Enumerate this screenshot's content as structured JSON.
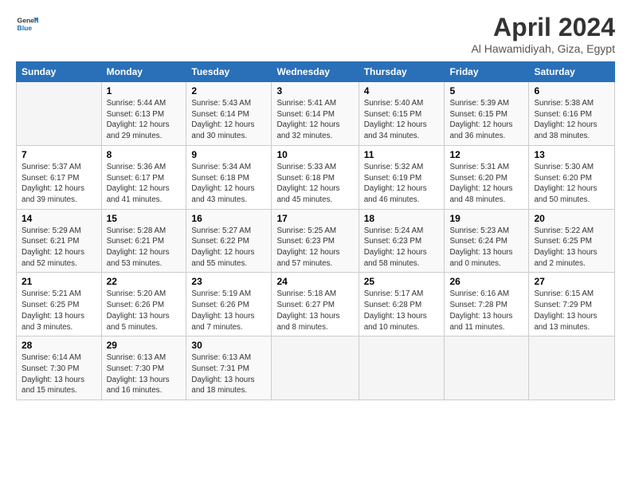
{
  "logo": {
    "line1": "General",
    "line2": "Blue"
  },
  "title": "April 2024",
  "location": "Al Hawamidiyah, Giza, Egypt",
  "days_header": [
    "Sunday",
    "Monday",
    "Tuesday",
    "Wednesday",
    "Thursday",
    "Friday",
    "Saturday"
  ],
  "weeks": [
    [
      {
        "num": "",
        "info": ""
      },
      {
        "num": "1",
        "info": "Sunrise: 5:44 AM\nSunset: 6:13 PM\nDaylight: 12 hours\nand 29 minutes."
      },
      {
        "num": "2",
        "info": "Sunrise: 5:43 AM\nSunset: 6:14 PM\nDaylight: 12 hours\nand 30 minutes."
      },
      {
        "num": "3",
        "info": "Sunrise: 5:41 AM\nSunset: 6:14 PM\nDaylight: 12 hours\nand 32 minutes."
      },
      {
        "num": "4",
        "info": "Sunrise: 5:40 AM\nSunset: 6:15 PM\nDaylight: 12 hours\nand 34 minutes."
      },
      {
        "num": "5",
        "info": "Sunrise: 5:39 AM\nSunset: 6:15 PM\nDaylight: 12 hours\nand 36 minutes."
      },
      {
        "num": "6",
        "info": "Sunrise: 5:38 AM\nSunset: 6:16 PM\nDaylight: 12 hours\nand 38 minutes."
      }
    ],
    [
      {
        "num": "7",
        "info": "Sunrise: 5:37 AM\nSunset: 6:17 PM\nDaylight: 12 hours\nand 39 minutes."
      },
      {
        "num": "8",
        "info": "Sunrise: 5:36 AM\nSunset: 6:17 PM\nDaylight: 12 hours\nand 41 minutes."
      },
      {
        "num": "9",
        "info": "Sunrise: 5:34 AM\nSunset: 6:18 PM\nDaylight: 12 hours\nand 43 minutes."
      },
      {
        "num": "10",
        "info": "Sunrise: 5:33 AM\nSunset: 6:18 PM\nDaylight: 12 hours\nand 45 minutes."
      },
      {
        "num": "11",
        "info": "Sunrise: 5:32 AM\nSunset: 6:19 PM\nDaylight: 12 hours\nand 46 minutes."
      },
      {
        "num": "12",
        "info": "Sunrise: 5:31 AM\nSunset: 6:20 PM\nDaylight: 12 hours\nand 48 minutes."
      },
      {
        "num": "13",
        "info": "Sunrise: 5:30 AM\nSunset: 6:20 PM\nDaylight: 12 hours\nand 50 minutes."
      }
    ],
    [
      {
        "num": "14",
        "info": "Sunrise: 5:29 AM\nSunset: 6:21 PM\nDaylight: 12 hours\nand 52 minutes."
      },
      {
        "num": "15",
        "info": "Sunrise: 5:28 AM\nSunset: 6:21 PM\nDaylight: 12 hours\nand 53 minutes."
      },
      {
        "num": "16",
        "info": "Sunrise: 5:27 AM\nSunset: 6:22 PM\nDaylight: 12 hours\nand 55 minutes."
      },
      {
        "num": "17",
        "info": "Sunrise: 5:25 AM\nSunset: 6:23 PM\nDaylight: 12 hours\nand 57 minutes."
      },
      {
        "num": "18",
        "info": "Sunrise: 5:24 AM\nSunset: 6:23 PM\nDaylight: 12 hours\nand 58 minutes."
      },
      {
        "num": "19",
        "info": "Sunrise: 5:23 AM\nSunset: 6:24 PM\nDaylight: 13 hours\nand 0 minutes."
      },
      {
        "num": "20",
        "info": "Sunrise: 5:22 AM\nSunset: 6:25 PM\nDaylight: 13 hours\nand 2 minutes."
      }
    ],
    [
      {
        "num": "21",
        "info": "Sunrise: 5:21 AM\nSunset: 6:25 PM\nDaylight: 13 hours\nand 3 minutes."
      },
      {
        "num": "22",
        "info": "Sunrise: 5:20 AM\nSunset: 6:26 PM\nDaylight: 13 hours\nand 5 minutes."
      },
      {
        "num": "23",
        "info": "Sunrise: 5:19 AM\nSunset: 6:26 PM\nDaylight: 13 hours\nand 7 minutes."
      },
      {
        "num": "24",
        "info": "Sunrise: 5:18 AM\nSunset: 6:27 PM\nDaylight: 13 hours\nand 8 minutes."
      },
      {
        "num": "25",
        "info": "Sunrise: 5:17 AM\nSunset: 6:28 PM\nDaylight: 13 hours\nand 10 minutes."
      },
      {
        "num": "26",
        "info": "Sunrise: 6:16 AM\nSunset: 7:28 PM\nDaylight: 13 hours\nand 11 minutes."
      },
      {
        "num": "27",
        "info": "Sunrise: 6:15 AM\nSunset: 7:29 PM\nDaylight: 13 hours\nand 13 minutes."
      }
    ],
    [
      {
        "num": "28",
        "info": "Sunrise: 6:14 AM\nSunset: 7:30 PM\nDaylight: 13 hours\nand 15 minutes."
      },
      {
        "num": "29",
        "info": "Sunrise: 6:13 AM\nSunset: 7:30 PM\nDaylight: 13 hours\nand 16 minutes."
      },
      {
        "num": "30",
        "info": "Sunrise: 6:13 AM\nSunset: 7:31 PM\nDaylight: 13 hours\nand 18 minutes."
      },
      {
        "num": "",
        "info": ""
      },
      {
        "num": "",
        "info": ""
      },
      {
        "num": "",
        "info": ""
      },
      {
        "num": "",
        "info": ""
      }
    ]
  ]
}
